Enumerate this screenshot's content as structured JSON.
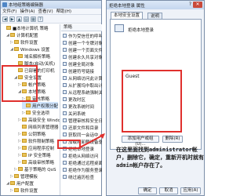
{
  "editor": {
    "title": "本地组策略编辑器",
    "menu": [
      "文件(F)",
      "操作(A)",
      "查看(V)",
      "帮助(H)"
    ],
    "tree_items": [
      {
        "label": "■本地计算机 策略",
        "indent": 0,
        "expander": ""
      },
      {
        "label": "计算机配置",
        "indent": 1,
        "expander": "◢"
      },
      {
        "label": "软件设置",
        "indent": 2,
        "expander": "▷"
      },
      {
        "label": "Windows 设置",
        "indent": 2,
        "expander": "◢"
      },
      {
        "label": "域名解析策略",
        "indent": 3,
        "expander": ""
      },
      {
        "label": "脚本(启动/关机)",
        "indent": 3,
        "expander": ""
      },
      {
        "label": "已部署的打印机",
        "indent": 3,
        "expander": ""
      },
      {
        "label": "安全设置",
        "indent": 3,
        "expander": "◢"
      },
      {
        "label": "帐户策略",
        "indent": 4,
        "expander": "▷"
      },
      {
        "label": "本地策略",
        "indent": 4,
        "expander": "◢"
      },
      {
        "label": "审核策略",
        "indent": 5,
        "expander": "▷"
      },
      {
        "label": "用户权限分配",
        "indent": 5,
        "expander": "",
        "selected": true
      },
      {
        "label": "安全选项",
        "indent": 5,
        "expander": "▷"
      },
      {
        "label": "高级安全 Windo",
        "indent": 4,
        "expander": "▷"
      },
      {
        "label": "网络列表管理器",
        "indent": 4,
        "expander": ""
      },
      {
        "label": "公钥策略",
        "indent": 4,
        "expander": "▷"
      },
      {
        "label": "软件限制策略",
        "indent": 4,
        "expander": "▷"
      },
      {
        "label": "应用程序控制",
        "indent": 4,
        "expander": "▷"
      },
      {
        "label": "IP 安全策略",
        "indent": 4,
        "expander": "▷"
      },
      {
        "label": "高级审核策略",
        "indent": 4,
        "expander": "▷"
      },
      {
        "label": "基于策略的 QoS",
        "indent": 3,
        "expander": "▷"
      },
      {
        "label": "管理模板",
        "indent": 2,
        "expander": "▷"
      },
      {
        "label": "用户配置",
        "indent": 1,
        "expander": "◢"
      },
      {
        "label": "软件设置",
        "indent": 2,
        "expander": "▷"
      }
    ],
    "policy_header": "策略",
    "policies": [
      "作为受信任的呼叫",
      "创建一个令牌对象",
      "创建一个页面文件",
      "创建永久共享对象",
      "创建全局对象",
      "创建符号链接",
      "从网络访问此计算机",
      "从扩展坞中取出计算机",
      "从远程系统强制关机",
      "更改时区",
      "更改系统时间",
      "关闭系统",
      "管理审核和安全日志",
      "还原文件和目录",
      "获取同一会话中",
      "加载和卸载设备驱动",
      "拒绝本地登录",
      "拒绝从网络访问",
      "拒绝通过远程桌面",
      "拒绝作为服务登录",
      "绕过遍历检查"
    ]
  },
  "dialog": {
    "title": "拒绝本地登录 属性",
    "close": "✕",
    "help": "?",
    "tab_active": "本地安全设置",
    "tab_other": "说明",
    "policy_name": "拒绝本地登录",
    "members": [
      "Guest"
    ],
    "add_button": "添加用户或组(U)...",
    "remove_button": "删除(R)",
    "ok_button": "确定",
    "cancel_button": "取消",
    "apply_button": "应用(A)"
  },
  "annotation": {
    "text": "在这里面找到administrator帐户，删除它，确定，重新开机时就有admin帐户存在了。"
  },
  "highlight_color": "#e0302d"
}
